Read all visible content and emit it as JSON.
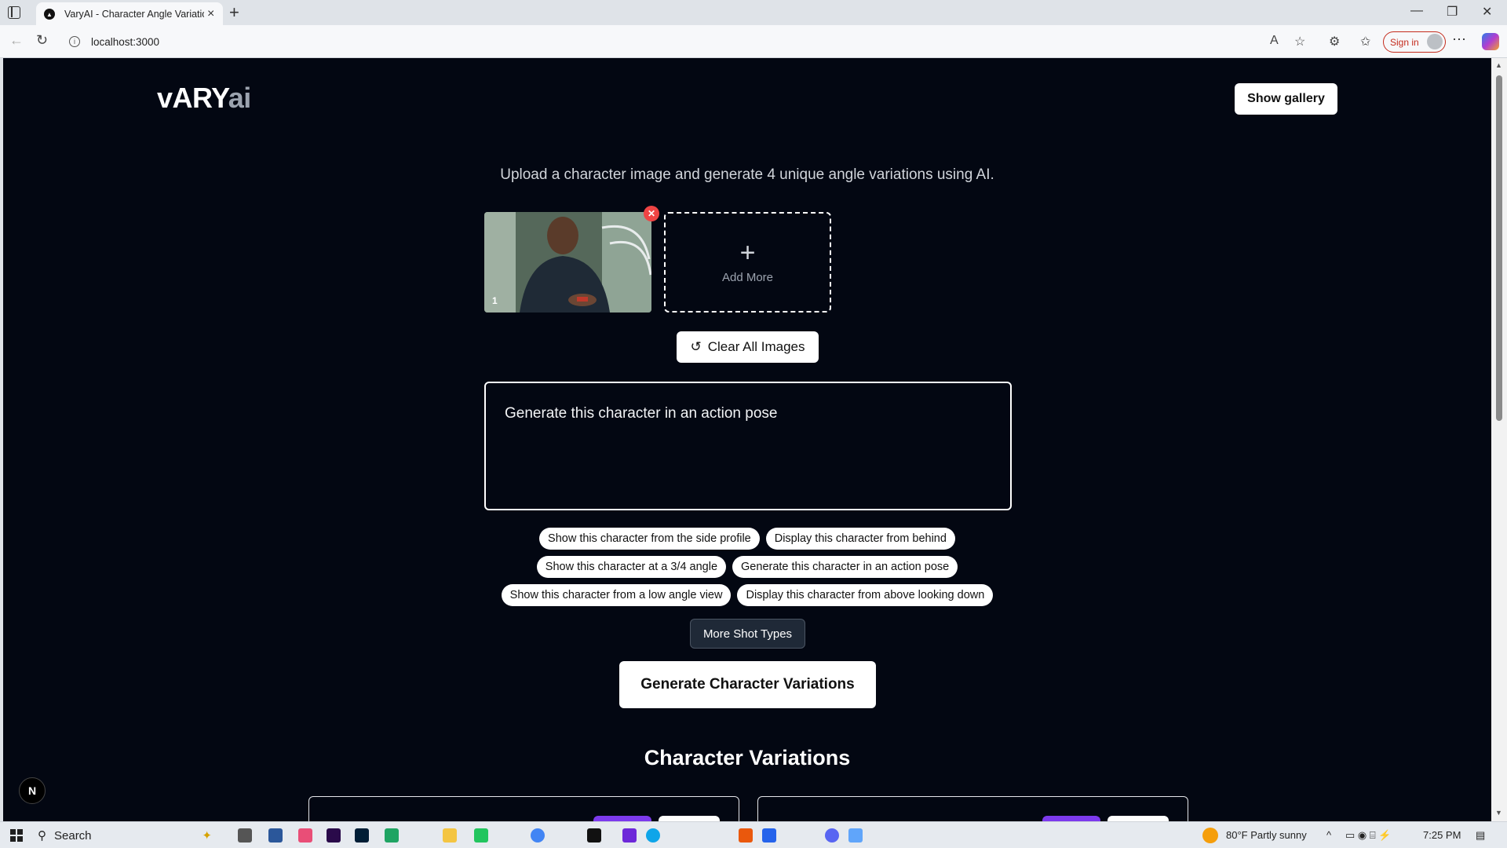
{
  "browser": {
    "tab_title": "VaryAI - Character Angle Variation",
    "url": "localhost:3000",
    "sign_in_label": "Sign in"
  },
  "app": {
    "logo_main": "vARY",
    "logo_suffix": "ai",
    "show_gallery_label": "Show gallery",
    "subtitle": "Upload a character image and generate 4 unique angle variations using AI.",
    "uploaded_images": [
      {
        "index": "1"
      }
    ],
    "add_more_label": "Add More",
    "clear_all_label": "Clear All Images",
    "prompt_value": "Generate this character in an action pose",
    "suggestions": [
      [
        "Show this character from the side profile",
        "Display this character from behind"
      ],
      [
        "Show this character at a 3/4 angle",
        "Generate this character in an action pose"
      ],
      [
        "Show this character from a low angle view",
        "Display this character from above looking down"
      ]
    ],
    "more_shot_types_label": "More Shot Types",
    "generate_label": "Generate Character Variations",
    "results_title": "Character Variations",
    "dev_badge": "N"
  },
  "taskbar": {
    "search_label": "Search",
    "weather": "80°F  Partly sunny",
    "time": "7:25 PM"
  },
  "colors": {
    "page_bg": "#030712",
    "accent_purple": "#7c3aed",
    "remove_red": "#ef4444"
  }
}
